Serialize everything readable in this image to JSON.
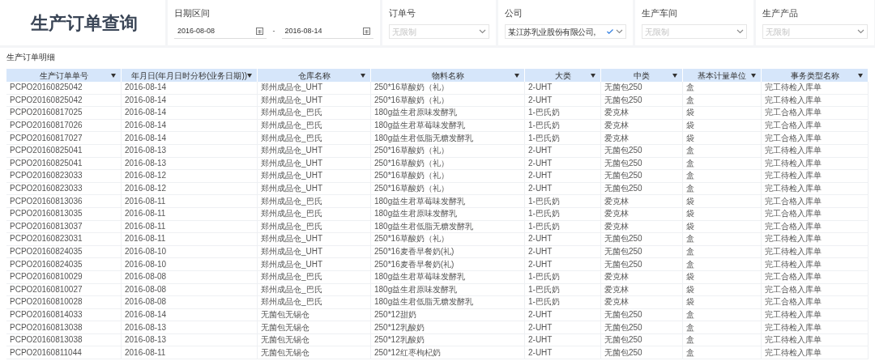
{
  "title": "生产订单查询",
  "filters": [
    {
      "kind": "date_range",
      "label": "日期区间",
      "start": "2016-08-08",
      "separator": "-",
      "end": "2016-08-14"
    },
    {
      "kind": "select",
      "label": "订单号",
      "placeholder": "无限制"
    },
    {
      "kind": "select",
      "label": "公司",
      "value": "某江苏乳业股份有限公司,"
    },
    {
      "kind": "select",
      "label": "生产车间",
      "placeholder": "无限制"
    },
    {
      "kind": "select",
      "label": "生产产品",
      "placeholder": "无限制"
    }
  ],
  "section_title": "生产订单明细",
  "table": {
    "columns": [
      "生产订单单号",
      "年月日(年月日时分秒(业务日期))",
      "仓库名称",
      "物料名称",
      "大类",
      "中类",
      "基本计量单位",
      "事务类型名称"
    ],
    "rows": [
      [
        "PCPO20160825042",
        "2016-08-14",
        "郑州成品仓_UHT",
        "250*16草酸奶（礼）",
        "2-UHT",
        "无菌包250",
        "盒",
        "完工待检入库单"
      ],
      [
        "PCPO20160825042",
        "2016-08-14",
        "郑州成品仓_UHT",
        "250*16草酸奶（礼）",
        "2-UHT",
        "无菌包250",
        "盒",
        "完工待检入库单"
      ],
      [
        "PCPO20160817025",
        "2016-08-14",
        "郑州成品仓_巴氏",
        "180g益生君原味发酵乳",
        "1-巴氏奶",
        "爱克林",
        "袋",
        "完工合格入库单"
      ],
      [
        "PCPO20160817026",
        "2016-08-14",
        "郑州成品仓_巴氏",
        "180g益生君草莓味发酵乳",
        "1-巴氏奶",
        "爱克林",
        "袋",
        "完工合格入库单"
      ],
      [
        "PCPO20160817027",
        "2016-08-14",
        "郑州成品仓_巴氏",
        "180g益生君低脂无糖发酵乳",
        "1-巴氏奶",
        "爱克林",
        "袋",
        "完工合格入库单"
      ],
      [
        "PCPO20160825041",
        "2016-08-13",
        "郑州成品仓_UHT",
        "250*16草酸奶（礼）",
        "2-UHT",
        "无菌包250",
        "盒",
        "完工待检入库单"
      ],
      [
        "PCPO20160825041",
        "2016-08-13",
        "郑州成品仓_UHT",
        "250*16草酸奶（礼）",
        "2-UHT",
        "无菌包250",
        "盒",
        "完工待检入库单"
      ],
      [
        "PCPO20160823033",
        "2016-08-12",
        "郑州成品仓_UHT",
        "250*16草酸奶（礼）",
        "2-UHT",
        "无菌包250",
        "盒",
        "完工待检入库单"
      ],
      [
        "PCPO20160823033",
        "2016-08-12",
        "郑州成品仓_UHT",
        "250*16草酸奶（礼）",
        "2-UHT",
        "无菌包250",
        "盒",
        "完工待检入库单"
      ],
      [
        "PCPO20160813036",
        "2016-08-11",
        "郑州成品仓_巴氏",
        "180g益生君草莓味发酵乳",
        "1-巴氏奶",
        "爱克林",
        "袋",
        "完工合格入库单"
      ],
      [
        "PCPO20160813035",
        "2016-08-11",
        "郑州成品仓_巴氏",
        "180g益生君原味发酵乳",
        "1-巴氏奶",
        "爱克林",
        "袋",
        "完工合格入库单"
      ],
      [
        "PCPO20160813037",
        "2016-08-11",
        "郑州成品仓_巴氏",
        "180g益生君低脂无糖发酵乳",
        "1-巴氏奶",
        "爱克林",
        "袋",
        "完工合格入库单"
      ],
      [
        "PCPO20160823031",
        "2016-08-11",
        "郑州成品仓_UHT",
        "250*16草酸奶（礼）",
        "2-UHT",
        "无菌包250",
        "盒",
        "完工待检入库单"
      ],
      [
        "PCPO20160824035",
        "2016-08-10",
        "郑州成品仓_UHT",
        "250*16麦香早餐奶(礼)",
        "2-UHT",
        "无菌包250",
        "盒",
        "完工待检入库单"
      ],
      [
        "PCPO20160824035",
        "2016-08-10",
        "郑州成品仓_UHT",
        "250*16麦香早餐奶(礼)",
        "2-UHT",
        "无菌包250",
        "盒",
        "完工待检入库单"
      ],
      [
        "PCPO20160810029",
        "2016-08-08",
        "郑州成品仓_巴氏",
        "180g益生君草莓味发酵乳",
        "1-巴氏奶",
        "爱克林",
        "袋",
        "完工合格入库单"
      ],
      [
        "PCPO20160810027",
        "2016-08-08",
        "郑州成品仓_巴氏",
        "180g益生君原味发酵乳",
        "1-巴氏奶",
        "爱克林",
        "袋",
        "完工合格入库单"
      ],
      [
        "PCPO20160810028",
        "2016-08-08",
        "郑州成品仓_巴氏",
        "180g益生君低脂无糖发酵乳",
        "1-巴氏奶",
        "爱克林",
        "袋",
        "完工合格入库单"
      ],
      [
        "PCPO20160814033",
        "2016-08-14",
        "无菌包无锡仓",
        "250*12甜奶",
        "2-UHT",
        "无菌包250",
        "盒",
        "完工待检入库单"
      ],
      [
        "PCPO20160813038",
        "2016-08-13",
        "无菌包无锡仓",
        "250*12乳酸奶",
        "2-UHT",
        "无菌包250",
        "盒",
        "完工待检入库单"
      ],
      [
        "PCPO20160813038",
        "2016-08-13",
        "无菌包无锡仓",
        "250*12乳酸奶",
        "2-UHT",
        "无菌包250",
        "盒",
        "完工待检入库单"
      ],
      [
        "PCPO20160811044",
        "2016-08-11",
        "无菌包无锡仓",
        "250*12红枣枸杞奶",
        "2-UHT",
        "无菌包250",
        "盒",
        "完工待检入库单"
      ]
    ]
  }
}
